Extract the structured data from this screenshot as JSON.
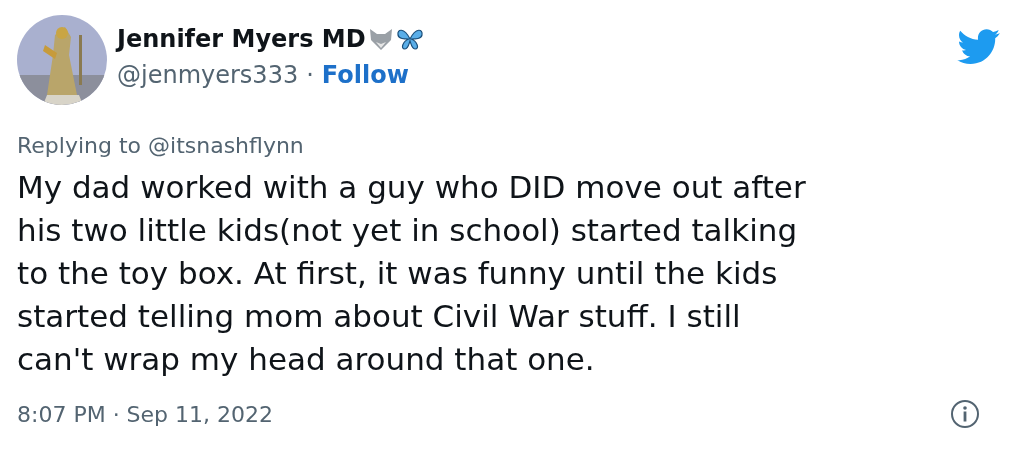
{
  "author": {
    "name": "Jennifer Myers MD",
    "handle": "@jenmyers333",
    "separator": "·",
    "follow": "Follow"
  },
  "reply_to": "Replying to @itsnashflynn",
  "text": "My dad worked with a guy who DID move out after\nhis two little kids(not yet in school) started talking\nto the toy box. At first, it was funny until the kids\nstarted telling mom about Civil War stuff. I still\ncan't wrap my head around that one.",
  "timestamp": "8:07 PM · Sep 11, 2022"
}
